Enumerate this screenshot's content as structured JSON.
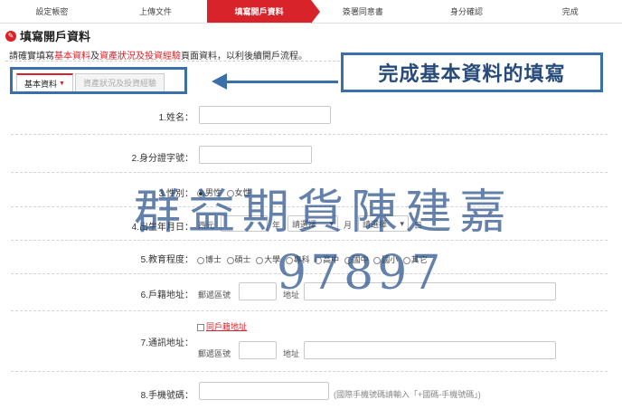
{
  "steps": [
    {
      "label": "設定帳密"
    },
    {
      "label": "上傳文件"
    },
    {
      "label": "填寫開戶資料"
    },
    {
      "label": "簽署同意書"
    },
    {
      "label": "身分確認"
    },
    {
      "label": "完成"
    }
  ],
  "page_title": "填寫開戶資料",
  "instruction": {
    "part1": "請確實填寫",
    "hl1": "基本資料",
    "part2": "及",
    "hl2": "資產狀況及投資經驗",
    "part3": "頁面資料，以利後續開戶流程。"
  },
  "tabs": {
    "basic": "基本資料",
    "asset": "資產狀況及投資經驗"
  },
  "callout": "完成基本資料的填寫",
  "form": {
    "name_label": "1.姓名：",
    "id_label": "2.身分證字號：",
    "gender_label": "3.性別：",
    "gender_male": "男性",
    "gender_female": "女性",
    "birth_label": "4.出生年月日：",
    "birth_era": "西元",
    "year_unit": "年",
    "month_select": "請選擇",
    "month_unit": "月",
    "day_select": "請選擇",
    "day_unit": "日",
    "edu_label": "5.教育程度：",
    "edu_options": [
      "博士",
      "碩士",
      "大學",
      "專科",
      "高中",
      "國中",
      "國小",
      "其它"
    ],
    "household_label": "6.戶籍地址：",
    "zip_label": "郵遞區號",
    "address_label": "地址",
    "same_as_household": "同戶籍地址",
    "mailing_label": "7.通訊地址：",
    "mobile_label": "8.手機號碼：",
    "mobile_hint": "(國際手機號碼請輸入「+國碼-手機號碼」)"
  },
  "watermark": {
    "name": "群益期貨陳建嘉",
    "number": "97897"
  }
}
